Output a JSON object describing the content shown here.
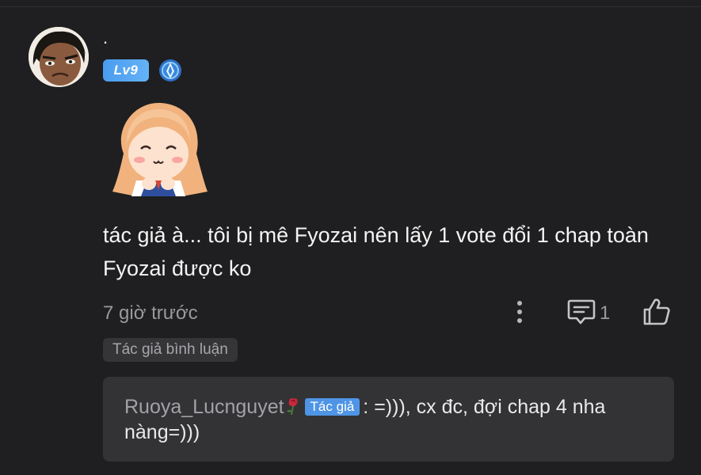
{
  "comment": {
    "username": ".",
    "level": "Lv9",
    "text": "tác giả à... tôi bị mê Fyozai nên lấy 1 vote đổi 1 chap toàn Fyozai được ko",
    "timestamp": "7 giờ trước",
    "reply_count": "1",
    "author_commented_tag": "Tác giả bình luận"
  },
  "reply": {
    "username": "Ruoya_Lucnguyet",
    "badge": "Tác giả",
    "text": ": =))), cx đc, đợi chap 4 nha nàng=)))"
  },
  "icons": {
    "avatar": "avatar",
    "rank": "rank-emblem-icon",
    "sticker": "happy-girl-sticker",
    "more": "more-vertical-icon",
    "reply": "comment-icon",
    "like": "thumbs-up-icon",
    "rose": "rose-icon"
  },
  "colors": {
    "background": "#1f1f21",
    "level_badge": "#4a9cf0",
    "author_badge": "#4f95e6",
    "reply_box": "#333336",
    "muted_text": "#9a9a9e"
  }
}
